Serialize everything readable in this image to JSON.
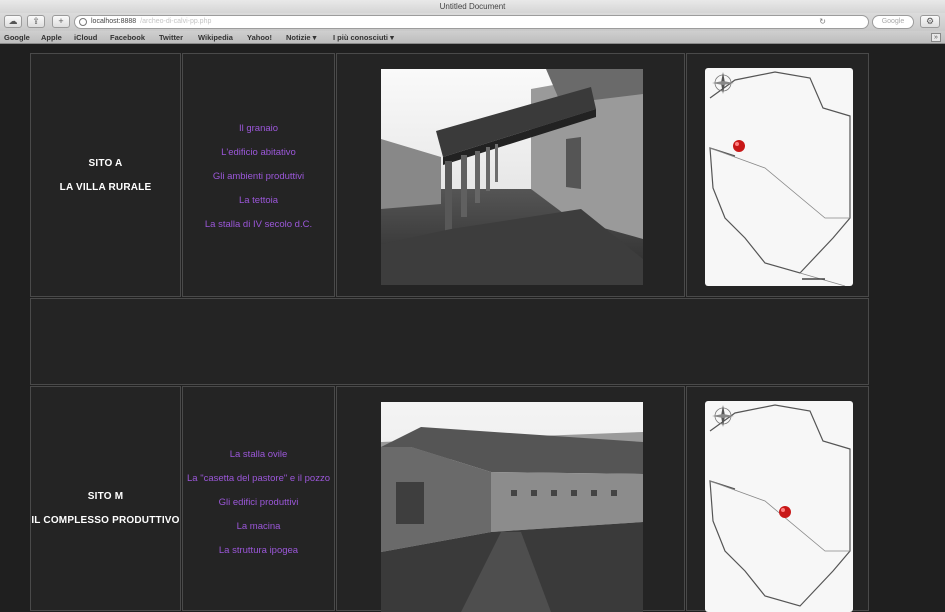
{
  "browser": {
    "window_title": "Untitled Document",
    "url": "localhost:8888",
    "url_rest": "/archeo-di-calvi-pp.php",
    "search_placeholder": "Google",
    "bookmarks": [
      "Google",
      "Apple",
      "iCloud",
      "Facebook",
      "Twitter",
      "Wikipedia",
      "Yahoo!",
      "Notizie ▾",
      "I più conosciuti ▾"
    ]
  },
  "sites": [
    {
      "title_line1": "SITO A",
      "title_line2": "LA VILLA RURALE",
      "links": [
        "Il granaio",
        "L'edificio abitativo",
        "Gli ambienti produttivi",
        "La tettoia",
        "La stalla di IV secolo d.C."
      ]
    },
    {
      "title_line1": "SITO M",
      "title_line2": "IL COMPLESSO PRODUTTIVO",
      "links": [
        "La stalla ovile",
        "La \"casetta del pastore\" e il pozzo",
        "Gli edifici produttivi",
        "La macina",
        "La struttura ipogea"
      ]
    }
  ],
  "icons": [
    "globe-icon",
    "reload-icon",
    "compass-rose-icon",
    "map-pin-icon"
  ],
  "colors": {
    "link": "#9b57d9",
    "background": "#1f1f1f",
    "cell_border": "#4a4a4a",
    "pin": "#c81818"
  }
}
